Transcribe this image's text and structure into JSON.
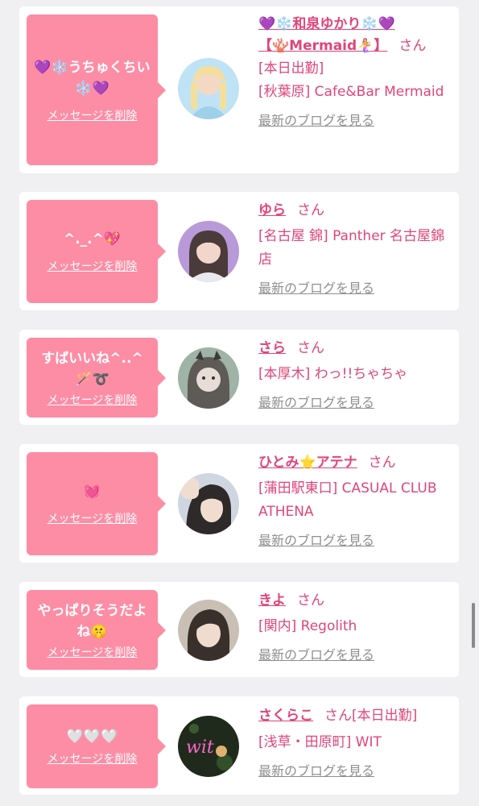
{
  "delete_label": "メッセージを削除",
  "blog_label": "最新のブログを見る",
  "san_label": "さん",
  "entries": [
    {
      "message": "💜❄️うちゅくちい❄️💜",
      "name_line1": "💜❄️和泉ゆかり❄️💜",
      "name_line2": "【🪸Mermaid🧜‍♀️】",
      "status": "[本日出勤]",
      "shop": "[秋葉原] Cafe&Bar Mermaid"
    },
    {
      "message": "^._.^💖",
      "name": "ゆら",
      "shop": "[名古屋 錦] Panther 名古屋錦店"
    },
    {
      "message": "すばいいね^..^🪄➰",
      "name": "さら",
      "shop": "[本厚木] わっ!!ちゃちゃ"
    },
    {
      "message": "💓",
      "name": "ひとみ⭐アテナ",
      "shop": "[蒲田駅東口] CASUAL CLUB ATHENA"
    },
    {
      "message": "やっぱりそうだよね🤫",
      "name": "きよ",
      "shop": "[関内] Regolith"
    },
    {
      "message": "🤍🤍🤍",
      "name": "さくらこ",
      "status": "[本日出勤]",
      "shop": "[浅草・田原町] WIT"
    }
  ],
  "colors": {
    "background": "#f0f0f2",
    "bubble": "#fd8da5",
    "name": "#e0457a",
    "blog_link": "#8f8f8f"
  },
  "icons": [
    "speech-bubble-arrow",
    "avatar-photo"
  ]
}
